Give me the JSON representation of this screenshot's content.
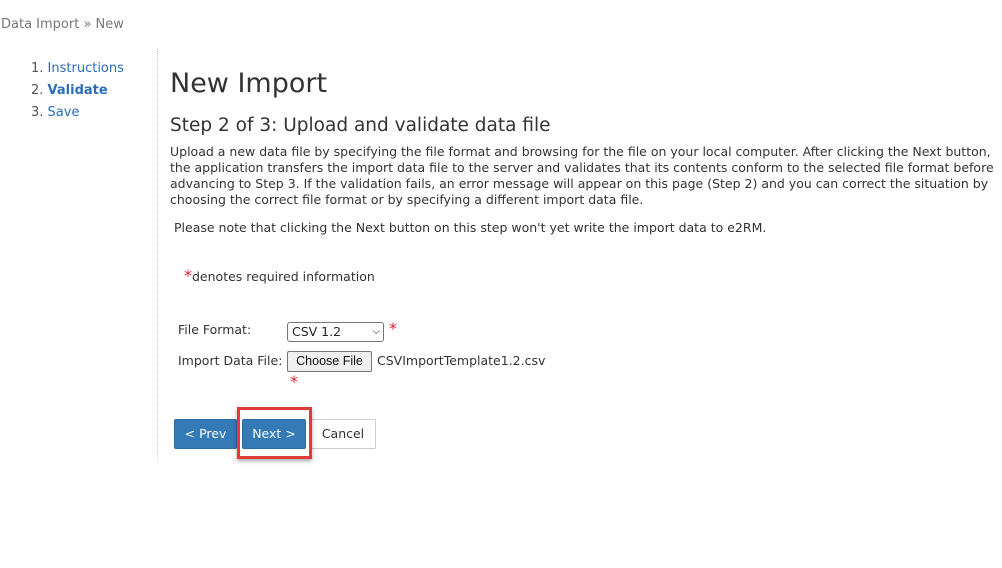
{
  "breadcrumb": {
    "text": "Data Import » New"
  },
  "steps": [
    {
      "number": "1.",
      "label": "Instructions"
    },
    {
      "number": "2.",
      "label": "Validate"
    },
    {
      "number": "3.",
      "label": "Save"
    }
  ],
  "page": {
    "title": "New Import",
    "step_title": "Step 2 of 3: Upload and validate data file",
    "description": "Upload a new data file by specifying the file format and browsing for the file on your local computer. After clicking the Next button, the application transfers the import data file to the server and validates that its contents conform to the selected file format before advancing to Step 3. If the validation fails, an error message will appear on this page (Step 2) and you can correct the situation by choosing the correct file format or by specifying a different import data file.",
    "note": "Please note that clicking the Next button on this step won't yet write the import data to e2RM."
  },
  "form": {
    "required_star": "*",
    "required_info": "denotes required information",
    "file_format_label": "File Format:",
    "file_format_value": "CSV 1.2",
    "import_file_label": "Import Data File:",
    "choose_file_label": "Choose File",
    "file_name": "CSVImportTemplate1.2.csv"
  },
  "buttons": {
    "prev": "< Prev",
    "next": "Next >",
    "cancel": "Cancel"
  },
  "colors": {
    "primary": "#337ab7",
    "link": "#2a6ebb",
    "required": "#d9232d",
    "highlight": "#e03a3a"
  }
}
